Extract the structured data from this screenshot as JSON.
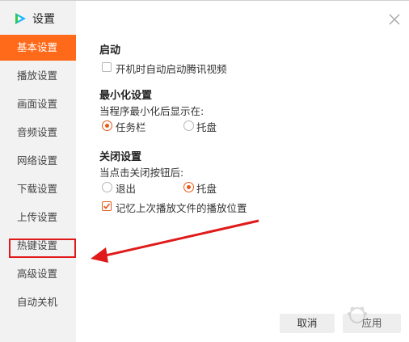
{
  "app": {
    "title": "设置"
  },
  "sidebar": {
    "items": [
      {
        "label": "基本设置",
        "active": true
      },
      {
        "label": "播放设置",
        "active": false
      },
      {
        "label": "画面设置",
        "active": false
      },
      {
        "label": "音频设置",
        "active": false
      },
      {
        "label": "网络设置",
        "active": false
      },
      {
        "label": "下载设置",
        "active": false
      },
      {
        "label": "上传设置",
        "active": false
      },
      {
        "label": "热键设置",
        "active": false
      },
      {
        "label": "高级设置",
        "active": false
      },
      {
        "label": "自动关机",
        "active": false
      }
    ]
  },
  "main": {
    "startup": {
      "title": "启动",
      "autostart_label": "开机时自动启动腾讯视频",
      "autostart_checked": false
    },
    "minimize": {
      "title": "最小化设置",
      "prompt": "当程序最小化后显示在:",
      "options": [
        {
          "label": "任务栏",
          "selected": true
        },
        {
          "label": "托盘",
          "selected": false
        }
      ]
    },
    "close": {
      "title": "关闭设置",
      "prompt": "当点击关闭按钮后:",
      "options": [
        {
          "label": "退出",
          "selected": false
        },
        {
          "label": "托盘",
          "selected": true
        }
      ],
      "remember_label": "记忆上次播放文件的播放位置",
      "remember_checked": true
    }
  },
  "footer": {
    "cancel_label": "取消",
    "apply_label": "应用"
  },
  "colors": {
    "accent": "#ff6a1a",
    "annotation": "#e01a1a"
  }
}
